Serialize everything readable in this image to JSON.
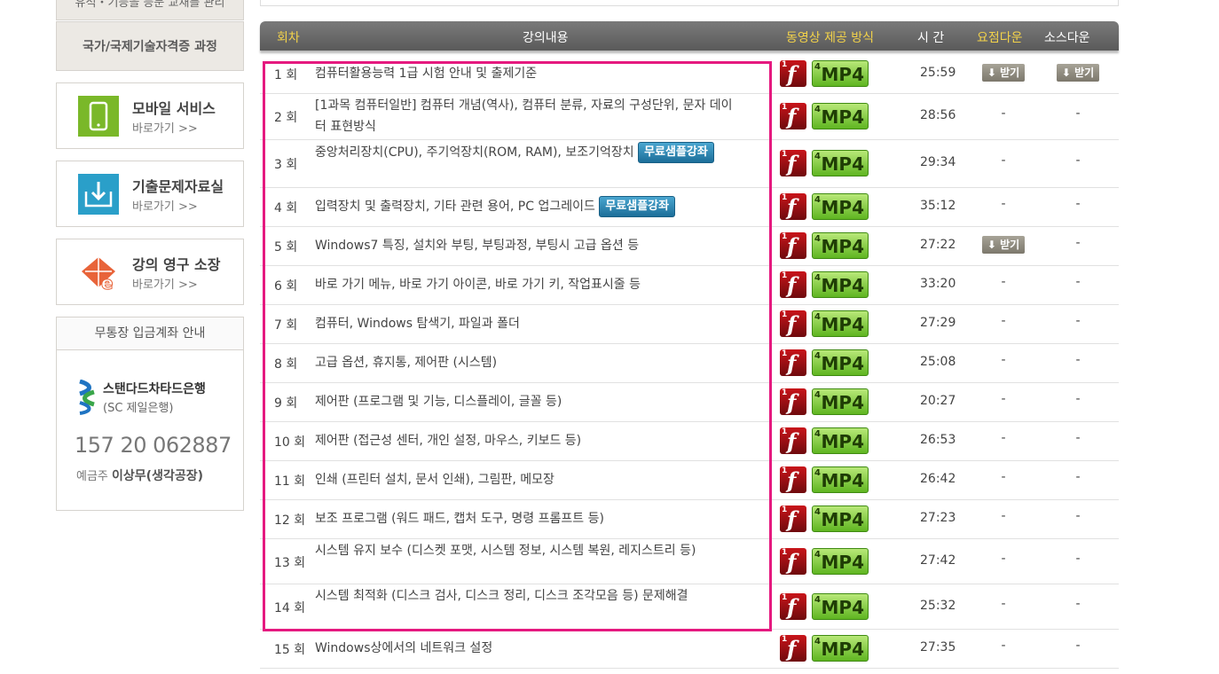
{
  "sidebar": {
    "top_cut_label": "유석・기능을 능문 교재를 관리",
    "nav_label": "국가/국제기술자격증 과정",
    "services": [
      {
        "title": "모바일 서비스",
        "link": "바로가기 >>",
        "icon": "mobile-icon",
        "color": "#7ab829"
      },
      {
        "title": "기출문제자료실",
        "link": "바로가기 >>",
        "icon": "download-box-icon",
        "color": "#2a9fc9"
      },
      {
        "title": "강의 영구 소장",
        "link": "바로가기 >>",
        "icon": "lecture-e-icon",
        "color": "#e8643a"
      }
    ],
    "bank": {
      "header": "무통장 입금계좌 안내",
      "bank_name": "스탠다드차타드은행",
      "bank_sub": "(SC 제일은행)",
      "account": "157 20 062887",
      "owner_label": "예금주",
      "owner_name": "이상무(생각공장)"
    }
  },
  "table": {
    "headers": {
      "no": "회차",
      "content": "강의내용",
      "method": "동영상 제공 방식",
      "time": "시 간",
      "summary": "요점다운",
      "source": "소스다운"
    },
    "badge_label": "무료샘플강좌",
    "download_label": "받기",
    "flash_icon": "flash-icon",
    "mp4_label": "MP4",
    "rows": [
      {
        "no": "1 회",
        "title": "컴퓨터활용능력 1급 시험 안내 및 출제기준",
        "time": "25:59",
        "summary": "받기",
        "source": "받기"
      },
      {
        "no": "2 회",
        "title": "[1과목 컴퓨터일반] 컴퓨터 개념(역사), 컴퓨터 분류, 자료의 구성단위, 문자 데이터 표현방식",
        "time": "28:56",
        "summary": "-",
        "source": "-"
      },
      {
        "no": "3 회",
        "title": "중앙처리장치(CPU), 주기억장치(ROM, RAM), 보조기억장치",
        "badge": true,
        "time": "29:34",
        "summary": "-",
        "source": "-"
      },
      {
        "no": "4 회",
        "title": "입력장치 및 출력장치, 기타 관련 용어, PC 업그레이드",
        "badge": true,
        "time": "35:12",
        "summary": "-",
        "source": "-"
      },
      {
        "no": "5 회",
        "title": "Windows7 특징, 설치와 부팅, 부팅과정, 부팅시 고급 옵션 등",
        "time": "27:22",
        "summary": "받기",
        "source": "-"
      },
      {
        "no": "6 회",
        "title": "바로 가기 메뉴, 바로 가기 아이콘, 바로 가기 키, 작업표시줄 등",
        "time": "33:20",
        "summary": "-",
        "source": "-"
      },
      {
        "no": "7 회",
        "title": "컴퓨터, Windows 탐색기, 파일과 폴더",
        "time": "27:29",
        "summary": "-",
        "source": "-"
      },
      {
        "no": "8 회",
        "title": "고급 옵션, 휴지통, 제어판 (시스템)",
        "time": "25:08",
        "summary": "-",
        "source": "-"
      },
      {
        "no": "9 회",
        "title": "제어판 (프로그램 및 기능, 디스플레이, 글꼴 등)",
        "time": "20:27",
        "summary": "-",
        "source": "-"
      },
      {
        "no": "10 회",
        "title": "제어판 (접근성 센터, 개인 설정, 마우스, 키보드 등)",
        "time": "26:53",
        "summary": "-",
        "source": "-"
      },
      {
        "no": "11 회",
        "title": "인쇄 (프린터 설치, 문서 인쇄), 그림판, 메모장",
        "time": "26:42",
        "summary": "-",
        "source": "-"
      },
      {
        "no": "12 회",
        "title": "보조 프로그램 (워드 패드, 캡처 도구, 명령 프롬프트 등)",
        "time": "27:23",
        "summary": "-",
        "source": "-"
      },
      {
        "no": "13 회",
        "title": "시스템 유지 보수 (디스켓 포맷, 시스템 정보, 시스템 복원, 레지스트리 등)",
        "time": "27:42",
        "summary": "-",
        "source": "-"
      },
      {
        "no": "14 회",
        "title": "시스템 최적화 (디스크 검사, 디스크 정리, 디스크 조각모음 등) 문제해결",
        "time": "25:32",
        "summary": "-",
        "source": "-"
      },
      {
        "no": "15 회",
        "title": "Windows상에서의 네트워크 설정",
        "time": "27:35",
        "summary": "-",
        "source": "-"
      }
    ]
  }
}
